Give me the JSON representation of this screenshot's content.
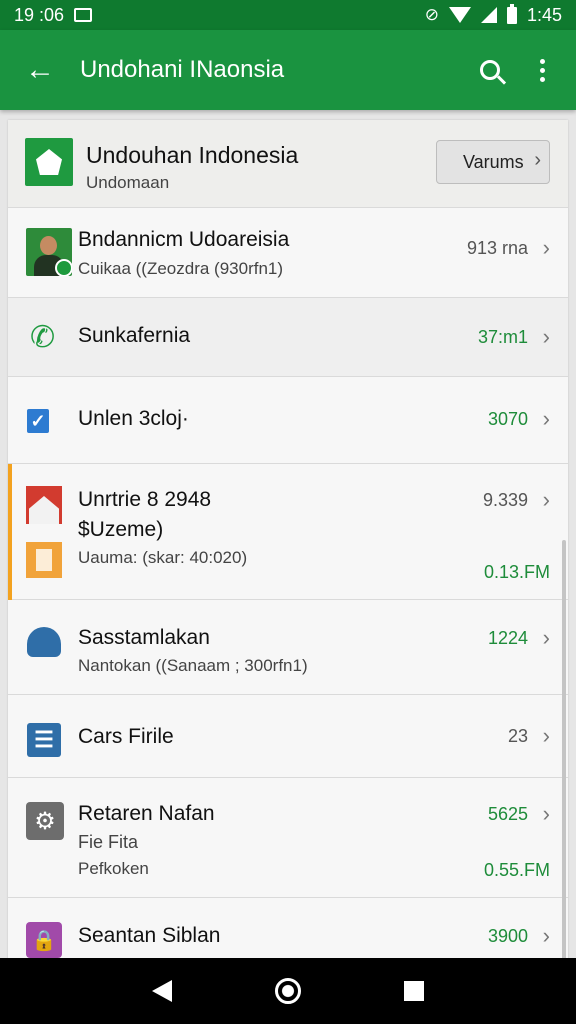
{
  "status_bar": {
    "time_left": "19 :06",
    "time_right": "1:45"
  },
  "app_bar": {
    "title": "Undohani INaonsia"
  },
  "header": {
    "title": "Undouhan Indonesia",
    "subtitle": "Undomaan",
    "button_label": "Varums"
  },
  "rows": [
    {
      "title": "Bndannicm Udoareisia",
      "subtitle": "Cuikaa ((Zeozdra (930rfn1)",
      "value": "913 rna",
      "value_color": "gray"
    },
    {
      "title": "Sunkafernia",
      "value": "37:m1",
      "value_color": "green"
    },
    {
      "title": "Unlen 3cloj·",
      "value": "3070",
      "value_color": "green"
    },
    {
      "title": "Unrtrie 8 2948",
      "subtitle": "$Uzeme)",
      "subtitle2": "Uauma: (skar: 40:020)",
      "value": "9.339",
      "value_color": "gray",
      "value2": "0.13.FM"
    },
    {
      "title": "Sasstamlakan",
      "subtitle": "Nantokan ((Sanaam ; 300rfn1)",
      "value": "1224",
      "value_color": "green"
    },
    {
      "title": "Cars Firile",
      "value": "23",
      "value_color": "gray"
    },
    {
      "title": "Retaren Nafan",
      "subtitle": "Fie Fita",
      "subtitle2": "Pefkoken",
      "value": "5625",
      "value_color": "green",
      "value2": "0.55.FM"
    },
    {
      "title": "Seantan Siblan",
      "value": "3900",
      "value_color": "green"
    }
  ],
  "colors": {
    "status_bar": "#0f7a2f",
    "app_bar": "#1a9340",
    "accent_green": "#1e8c3a",
    "accent_orange": "#f3a21f"
  },
  "icons": [
    "back-arrow-icon",
    "search-icon",
    "more-vert-icon",
    "app-logo-icon",
    "avatar",
    "phone-icon",
    "checkbox-icon",
    "image-icon",
    "bell-icon",
    "file-icon",
    "gear-icon",
    "lock-icon"
  ]
}
